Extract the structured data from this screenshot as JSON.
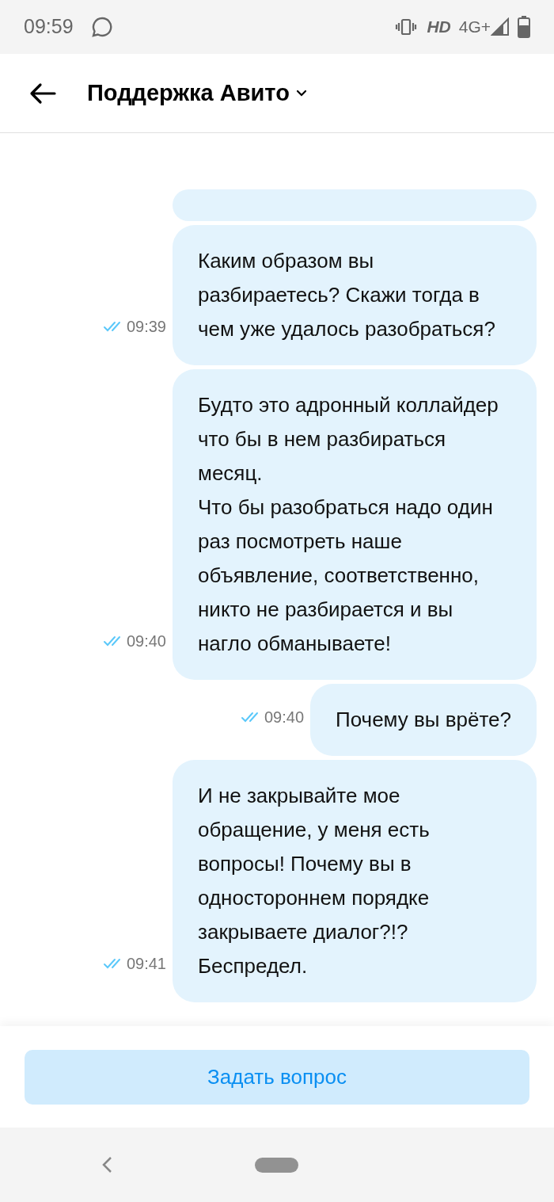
{
  "status_bar": {
    "time": "09:59",
    "hd": "HD",
    "network": "4G+"
  },
  "header": {
    "title": "Поддержка Авито"
  },
  "messages": [
    {
      "text": "Каким образом вы разбираетесь? Скажи тогда в чем уже удалось разобраться?",
      "time": "09:39",
      "read": true
    },
    {
      "text": "Будто это адронный коллайдер что бы в нем разбираться месяц.\nЧто бы разобраться надо один раз посмотреть наше объявление, соответственно, никто не разбирается и вы нагло обманываете!",
      "time": "09:40",
      "read": true
    },
    {
      "text": "Почему вы врёте?",
      "time": "09:40",
      "read": true
    },
    {
      "text": "И не закрывайте мое обращение, у меня есть вопросы! Почему вы в одностороннем порядке закрываете диалог?!? Беспредел.",
      "time": "09:41",
      "read": true
    }
  ],
  "footer": {
    "button": "Задать вопрос"
  }
}
